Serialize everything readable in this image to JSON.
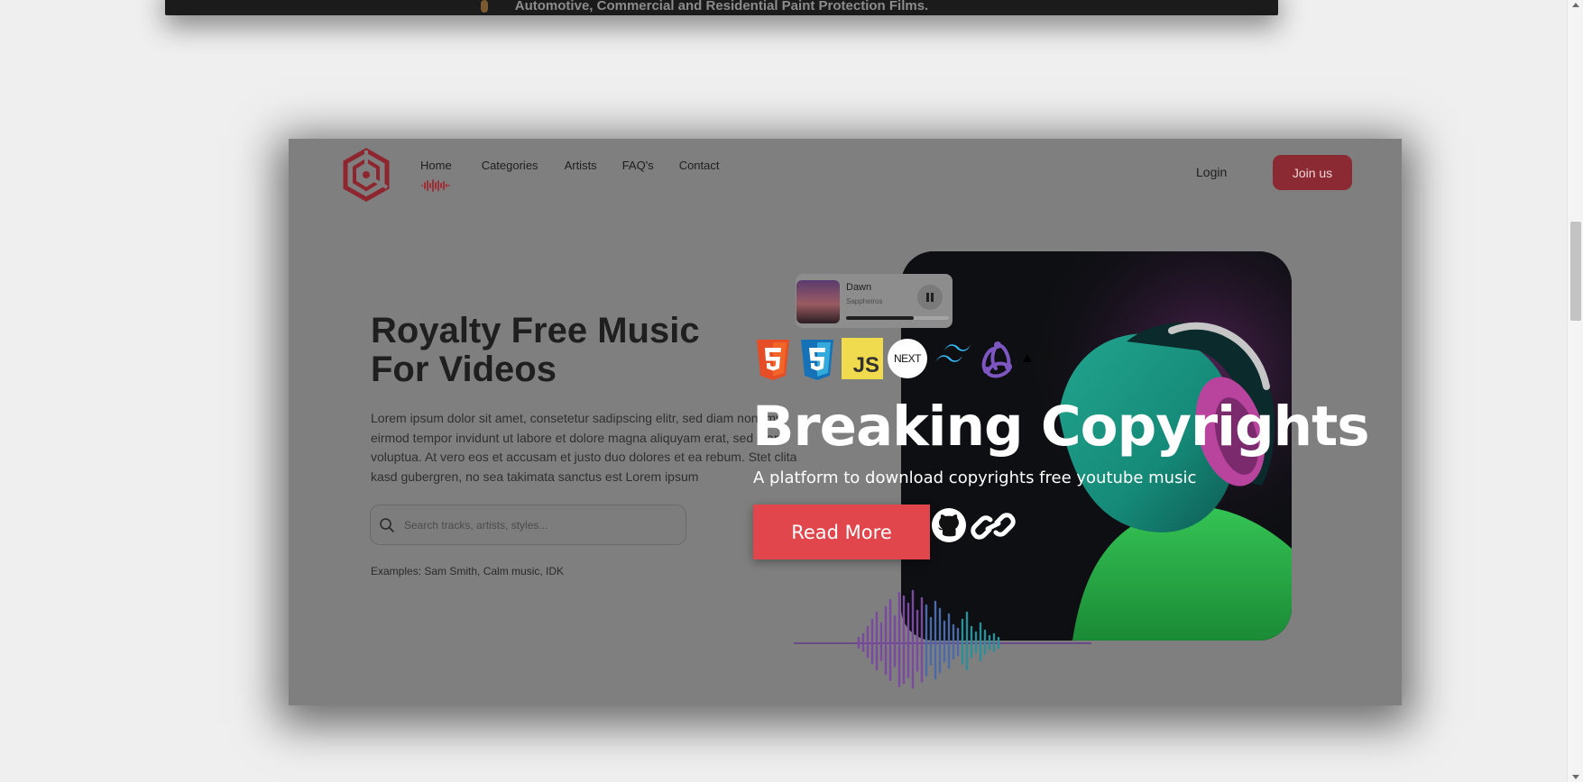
{
  "previous_card": {
    "caption": "Automotive, Commercial and Residential Paint Protection Films."
  },
  "nav": {
    "items": [
      "Home",
      "Categories",
      "Artists",
      "FAQ's",
      "Contact"
    ],
    "login": "Login",
    "join": "Join us"
  },
  "hero": {
    "title": "Royalty Free Music For Videos",
    "paragraph": "Lorem ipsum dolor sit amet, consetetur sadipscing elitr, sed diam nonumy eirmod tempor invidunt ut labore et dolore magna aliquyam erat, sed diam voluptua. At vero eos et accusam et justo duo dolores et ea rebum. Stet clita kasd gubergren, no sea takimata sanctus est Lorem ipsum",
    "search_placeholder": "Search tracks, artists, styles...",
    "examples": "Examples: Sam Smith, Calm music, IDK"
  },
  "player": {
    "track": "Dawn",
    "artist": "Sappheiros",
    "progress": 0.66
  },
  "overlay": {
    "tech_icons": [
      "html5-icon",
      "css3-icon",
      "javascript-icon",
      "nextjs-icon",
      "tailwind-icon",
      "redux-icon",
      "vercel-icon"
    ],
    "js_label": "JS",
    "next_label": "NEXT",
    "vercel_label": "Vercel",
    "heading": "Breaking Copyrights",
    "subheading": "A platform to download copyrights free youtube music",
    "button": "Read More"
  },
  "colors": {
    "accent": "#e0464c",
    "join_bg": "#8b2a32",
    "logo": "#8e2630"
  }
}
